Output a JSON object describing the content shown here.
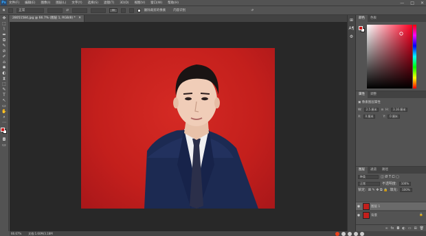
{
  "app": {
    "logo": "Ps"
  },
  "menu": [
    "文件(F)",
    "编辑(E)",
    "图像(I)",
    "图层(L)",
    "文字(Y)",
    "选择(S)",
    "滤镜(T)",
    "3D(D)",
    "视图(V)",
    "窗口(W)",
    "帮助(H)"
  ],
  "window_controls": [
    "—",
    "□",
    "✕"
  ],
  "options": {
    "style": "正常",
    "check_label": "删除裁剪的像素",
    "content_aware": "内容识别"
  },
  "document": {
    "tab_title": "28051584.jpg @ 66.7% (图层 1, RGB/8) *"
  },
  "status": {
    "zoom": "66.67%",
    "doc_info": "文档:1.60M/3.18M"
  },
  "tools": [
    "✥",
    "⬚",
    "⌇",
    "⬌",
    "⧉",
    "✎",
    "⊘",
    "✐",
    "⌂",
    "✱",
    "◐",
    "⧗",
    "⬚",
    "✎",
    "T",
    "↖",
    "▭",
    "✋",
    "⌕",
    "⋯"
  ],
  "dock_icons": [
    "⊞",
    "A¶",
    "⚙"
  ],
  "color_panel": {
    "tabs": [
      "颜色",
      "色板"
    ],
    "fg": "#c8191a",
    "bg": "#ffffff"
  },
  "properties": {
    "tabs": [
      "属性",
      "调整"
    ],
    "section": "像素图层属性",
    "w_label": "W:",
    "w_value": "2.5 厘米",
    "link_icon": "⊝",
    "h_label": "H:",
    "h_value": "3.16 厘米",
    "x_label": "X:",
    "x_value": "0 厘米",
    "y_label": "Y:",
    "y_value": "0 厘米"
  },
  "layers_panel": {
    "tabs": [
      "图层",
      "通道",
      "路径"
    ],
    "kind": "种类",
    "blend": "正常",
    "opacity_label": "不透明度:",
    "opacity": "100%",
    "lock_label": "锁定:",
    "fill_label": "填充:",
    "fill": "100%",
    "layers": [
      {
        "name": "图层 1",
        "selected": true
      },
      {
        "name": "背景",
        "selected": false
      }
    ],
    "bottom_icons": [
      "∞",
      "fx",
      "◘",
      "◐",
      "▭",
      "⊞",
      "🗑"
    ]
  }
}
